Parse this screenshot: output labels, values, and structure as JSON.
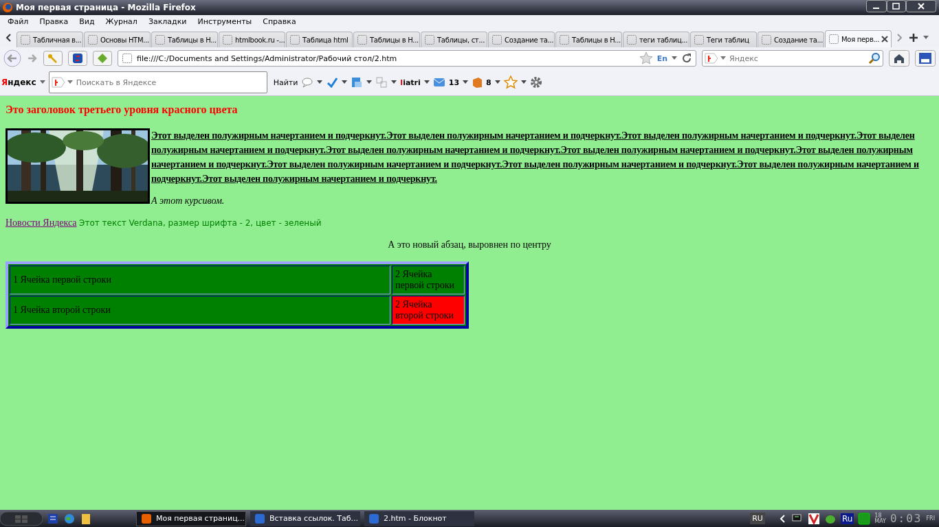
{
  "window": {
    "title": "Моя первая страница - Mozilla Firefox"
  },
  "menu": [
    "Файл",
    "Правка",
    "Вид",
    "Журнал",
    "Закладки",
    "Инструменты",
    "Справка"
  ],
  "tabs": [
    {
      "label": "Табличная в...",
      "selected": false
    },
    {
      "label": "Основы HTM...",
      "selected": false
    },
    {
      "label": "Таблицы в H...",
      "selected": false
    },
    {
      "label": "htmlbook.ru -...",
      "selected": false
    },
    {
      "label": "Таблица html",
      "selected": false
    },
    {
      "label": "Таблицы в H...",
      "selected": false
    },
    {
      "label": "Таблицы, ст...",
      "selected": false
    },
    {
      "label": "Создание та...",
      "selected": false
    },
    {
      "label": "Таблицы в H...",
      "selected": false
    },
    {
      "label": "теги таблиц...",
      "selected": false
    },
    {
      "label": "Теги таблиц",
      "selected": false
    },
    {
      "label": "Создание та...",
      "selected": false
    },
    {
      "label": "Моя перв...",
      "selected": true
    }
  ],
  "address": {
    "value": "file:///C:/Documents and Settings/Administrator/Рабочий стол/2.htm",
    "lang": "En"
  },
  "search": {
    "placeholder": "Яндекс"
  },
  "yandex_bar": {
    "brand": "Яндекс",
    "placeholder": "Поискать в Яндексе",
    "find": "Найти",
    "user": "liatri",
    "mail_count": "13",
    "count": "8"
  },
  "page": {
    "heading": "Это заголовок третьего уровня красного цвета",
    "bold_text": "Этот выделен полужирным начертанием и подчеркнут.Этот выделен полужирным начертанием и подчеркнут.Этот выделен полужирным начертанием и подчеркнут.Этот выделен полужирным начертанием и подчеркнут.Этот выделен полужирным начертанием и подчеркнут.Этот выделен полужирным начертанием и подчеркнут.Этот выделен полужирным начертанием и подчеркнут.Этот выделен полужирным начертанием и подчеркнут.Этот выделен полужирным начертанием и подчеркнут.Этот выделен полужирным начертанием и подчеркнут.Этот выделен полужирным начертанием и подчеркнут.",
    "italic_text": "А этот курсивом.",
    "link": "Новости Яндекса",
    "green_text": "Этот текст Verdana, размер шрифта - 2, цвет - зеленый",
    "centered_text": "А это новый абзац, выровнен по центру",
    "table": {
      "rows": [
        [
          {
            "text": "1 Ячейка первой строки",
            "color": "#008000"
          },
          {
            "text": "2 Ячейка первой строки",
            "color": "#008000"
          }
        ],
        [
          {
            "text": "1 Ячейка второй строки",
            "color": "#008000"
          },
          {
            "text": "2 Ячейка второй строки",
            "color": "#ff0000"
          }
        ]
      ]
    }
  },
  "taskbar": {
    "tasks": [
      {
        "label": "Моя первая страниц...",
        "selected": true
      },
      {
        "label": "Вставка ссылок. Таб...",
        "selected": false
      },
      {
        "label": "2.htm - Блокнот",
        "selected": false
      }
    ],
    "lang": "RU",
    "tray_lang": "Ru",
    "date": "18",
    "month": "MAY",
    "time": "0:03",
    "weekday": "FRI"
  }
}
